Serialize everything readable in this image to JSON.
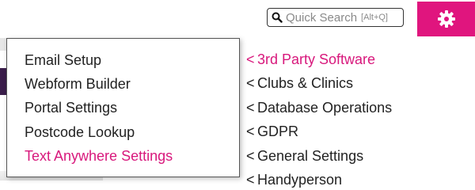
{
  "search": {
    "label": "Quick Search",
    "shortcut": "[Alt+Q]"
  },
  "icons": {
    "search": "search-icon",
    "settings": "gear-icon",
    "chevron": "chevron-left-icon"
  },
  "colors": {
    "accent": "#e0157e",
    "active_text": "#d8187c",
    "text": "#222222"
  },
  "submenu": {
    "items": [
      {
        "label": "Email Setup",
        "active": false
      },
      {
        "label": "Webform Builder",
        "active": false
      },
      {
        "label": "Portal Settings",
        "active": false
      },
      {
        "label": "Postcode Lookup",
        "active": false
      },
      {
        "label": "Text Anywhere Settings",
        "active": true
      }
    ]
  },
  "categories": {
    "chevron": "<",
    "items": [
      {
        "label": "3rd Party Software",
        "active": true
      },
      {
        "label": "Clubs & Clinics",
        "active": false
      },
      {
        "label": "Database Operations",
        "active": false
      },
      {
        "label": "GDPR",
        "active": false
      },
      {
        "label": "General Settings",
        "active": false
      },
      {
        "label": "Handyperson",
        "active": false
      }
    ]
  }
}
